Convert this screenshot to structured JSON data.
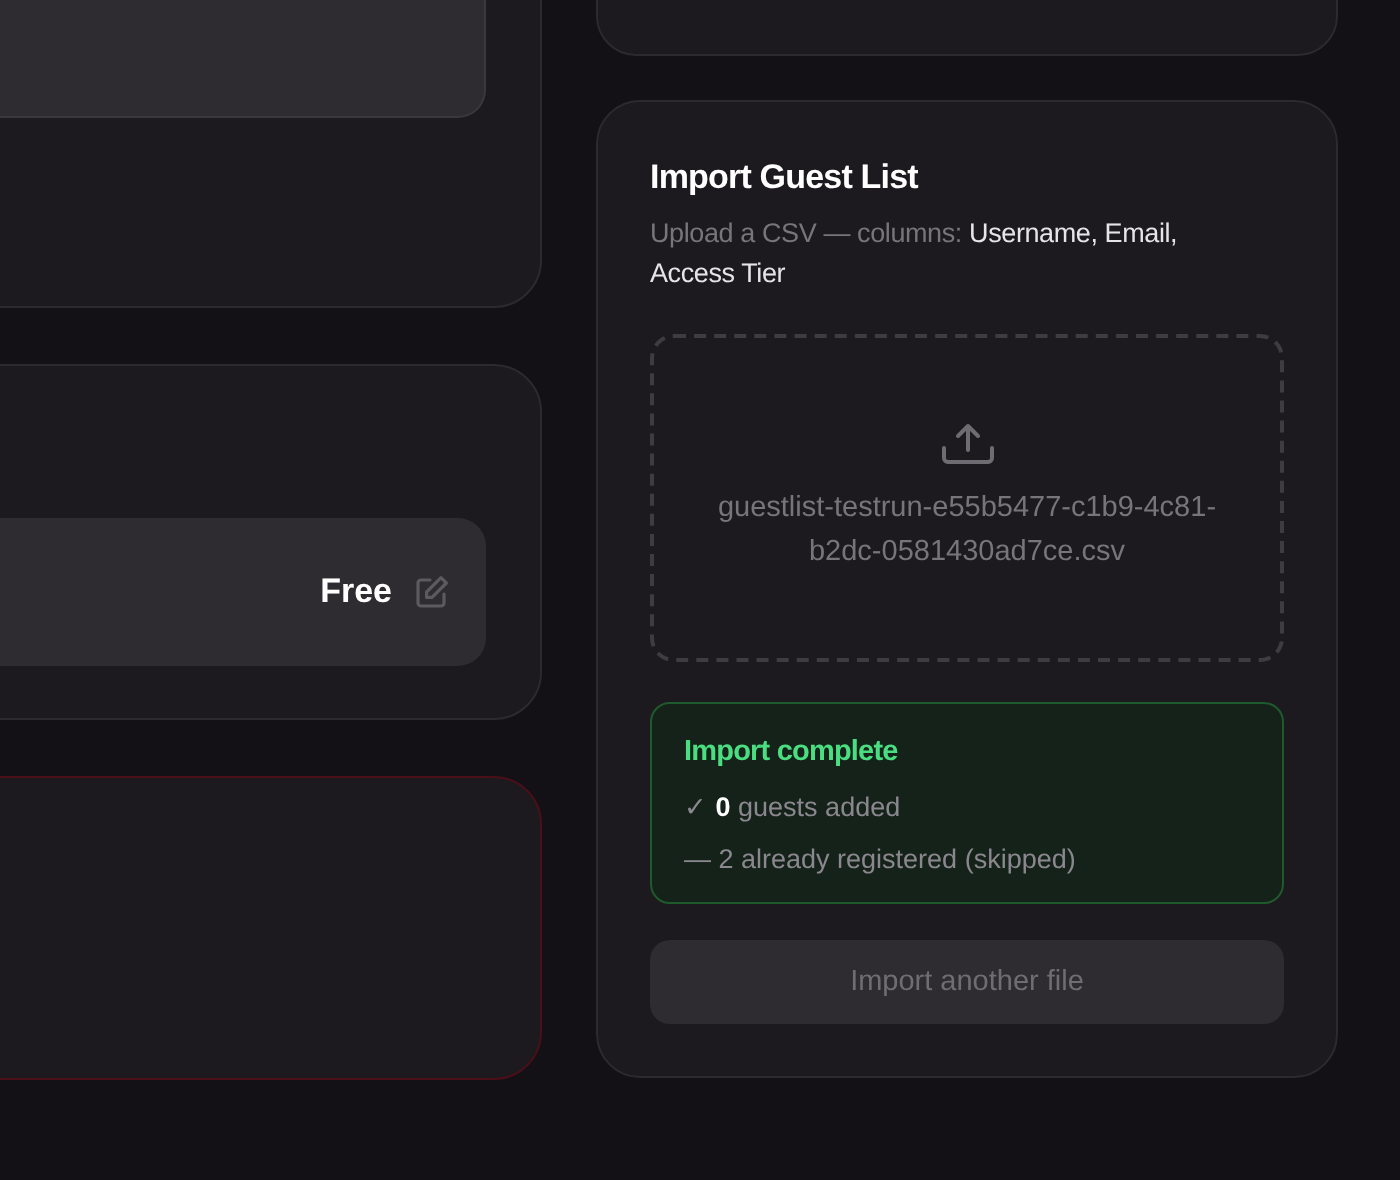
{
  "left_cards": [
    {
      "kind": "panel"
    },
    {
      "kind": "tier",
      "tier": {
        "value": "Free"
      }
    },
    {
      "kind": "danger"
    }
  ],
  "import_card": {
    "title": "Import Guest List",
    "subtitle": "Upload a CSV — columns: **Username, Email, Access Tier**",
    "dropzone": {
      "filename": "guestlist-testrun-e55b5477-c1b9-4c81-b2dc-0581430ad7ce.csv"
    },
    "result": {
      "kind": "success",
      "title": "Import complete",
      "lines": [
        "✓ **0** guests added",
        "— 2 already registered (skipped)"
      ]
    },
    "button": {
      "label": "Import another file",
      "disabled": true
    }
  }
}
